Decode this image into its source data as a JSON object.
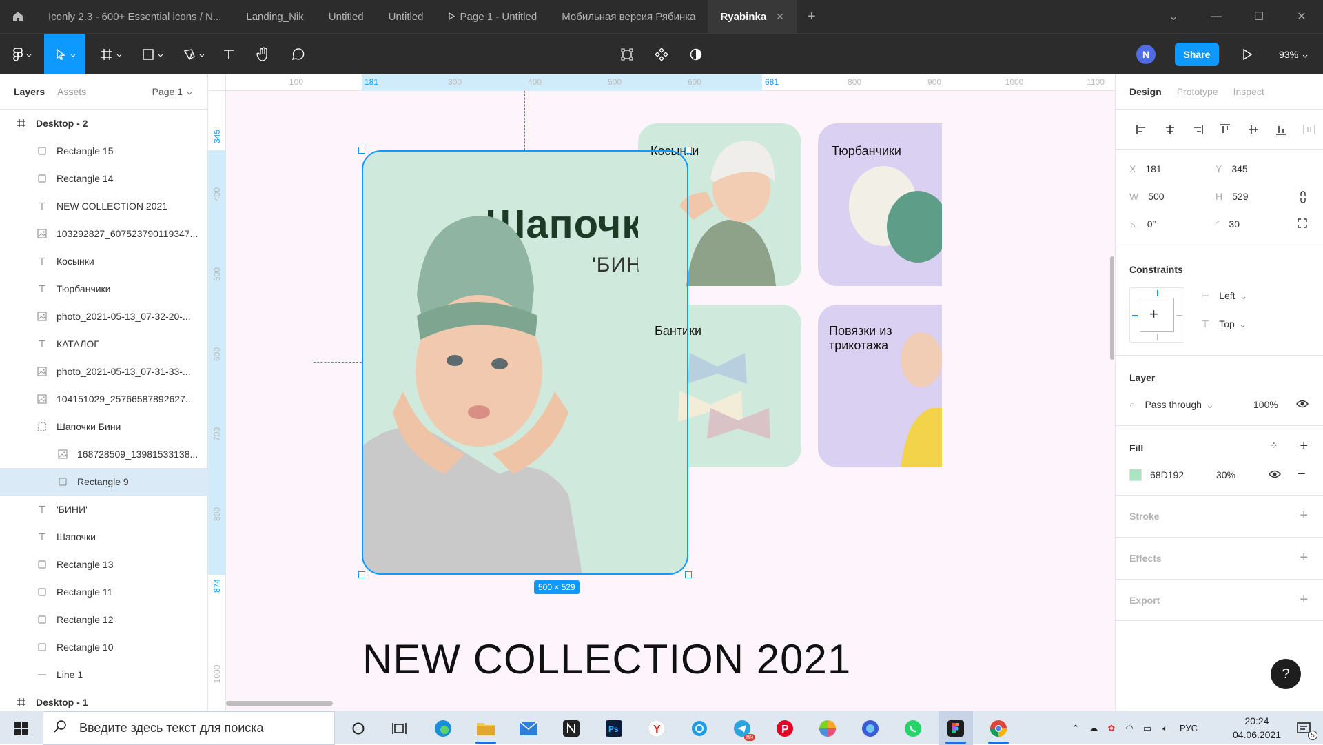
{
  "tabs": [
    {
      "label": "Iconly 2.3 - 600+ Essential icons / N...",
      "active": false,
      "play": false
    },
    {
      "label": "Landing_Nik",
      "active": false,
      "play": false
    },
    {
      "label": "Untitled",
      "active": false,
      "play": false
    },
    {
      "label": "Untitled",
      "active": false,
      "play": false
    },
    {
      "label": "Page 1 - Untitled",
      "active": false,
      "play": true
    },
    {
      "label": "Мобильная версия Рябинка",
      "active": false,
      "play": false
    },
    {
      "label": "Ryabinka",
      "active": true,
      "play": false
    }
  ],
  "toolbar": {
    "share_label": "Share",
    "zoom_label": "93%",
    "avatar_initial": "N"
  },
  "left_panel": {
    "tabs": {
      "layers": "Layers",
      "assets": "Assets"
    },
    "page_label": "Page 1",
    "layers": [
      {
        "name": "Desktop - 2",
        "icon": "frame-icon",
        "indent": 0,
        "frame": true
      },
      {
        "name": "Rectangle 15",
        "icon": "rectangle-icon",
        "indent": 1
      },
      {
        "name": "Rectangle 14",
        "icon": "rectangle-icon",
        "indent": 1
      },
      {
        "name": "NEW COLLECTION 2021",
        "icon": "text-icon",
        "indent": 1
      },
      {
        "name": "103292827_607523790119347...",
        "icon": "image-icon",
        "indent": 1
      },
      {
        "name": "Косынки",
        "icon": "text-icon",
        "indent": 1
      },
      {
        "name": "Тюрбанчики",
        "icon": "text-icon",
        "indent": 1
      },
      {
        "name": "photo_2021-05-13_07-32-20-...",
        "icon": "image-icon",
        "indent": 1
      },
      {
        "name": "КАТАЛОГ",
        "icon": "text-icon",
        "indent": 1
      },
      {
        "name": "photo_2021-05-13_07-31-33-...",
        "icon": "image-icon",
        "indent": 1
      },
      {
        "name": "104151029_25766587892627...",
        "icon": "image-icon",
        "indent": 1
      },
      {
        "name": "Шапочки Бини",
        "icon": "group-icon",
        "indent": 1
      },
      {
        "name": "168728509_13981533138...",
        "icon": "image-icon",
        "indent": 2
      },
      {
        "name": "Rectangle 9",
        "icon": "rectangle-icon",
        "indent": 2,
        "selected": true
      },
      {
        "name": "'БИНИ'",
        "icon": "text-icon",
        "indent": 1
      },
      {
        "name": "Шапочки",
        "icon": "text-icon",
        "indent": 1
      },
      {
        "name": "Rectangle 13",
        "icon": "rectangle-icon",
        "indent": 1
      },
      {
        "name": "Rectangle 11",
        "icon": "rectangle-icon",
        "indent": 1
      },
      {
        "name": "Rectangle 12",
        "icon": "rectangle-icon",
        "indent": 1
      },
      {
        "name": "Rectangle 10",
        "icon": "rectangle-icon",
        "indent": 1
      },
      {
        "name": "Line 1",
        "icon": "line-icon",
        "indent": 1
      },
      {
        "name": "Desktop - 1",
        "icon": "frame-icon",
        "indent": 0,
        "frame": true
      }
    ]
  },
  "rulers": {
    "top": [
      {
        "label": "100",
        "hl": false
      },
      {
        "label": "181",
        "hl": true
      },
      {
        "label": "300",
        "hl": false
      },
      {
        "label": "400",
        "hl": false
      },
      {
        "label": "500",
        "hl": false
      },
      {
        "label": "600",
        "hl": false
      },
      {
        "label": "681",
        "hl": true
      },
      {
        "label": "800",
        "hl": false
      },
      {
        "label": "900",
        "hl": false
      },
      {
        "label": "1000",
        "hl": false
      },
      {
        "label": "1100",
        "hl": false
      }
    ],
    "left": [
      {
        "label": "345",
        "hl": true
      },
      {
        "label": "400",
        "hl": false
      },
      {
        "label": "500",
        "hl": false
      },
      {
        "label": "600",
        "hl": false
      },
      {
        "label": "700",
        "hl": false
      },
      {
        "label": "800",
        "hl": false
      },
      {
        "label": "874",
        "hl": true
      },
      {
        "label": "1000",
        "hl": false
      }
    ]
  },
  "canvas": {
    "hero_title": "Шапочки",
    "hero_subtitle": "'БИНИ'",
    "cards": {
      "kosynki": "Косынки",
      "turbanchiki": "Тюрбанчики",
      "bantiki": "Бантики",
      "povyazki": "Повязки из трикотажа"
    },
    "new_collection": "NEW COLLECTION 2021",
    "size_badge": "500 × 529"
  },
  "right_panel": {
    "tabs": {
      "design": "Design",
      "prototype": "Prototype",
      "inspect": "Inspect"
    },
    "x_label": "X",
    "x": "181",
    "y_label": "Y",
    "y": "345",
    "w_label": "W",
    "w": "500",
    "h_label": "H",
    "h": "529",
    "rotation": "0°",
    "radius": "30",
    "constraints_title": "Constraints",
    "constraint_h": "Left",
    "constraint_v": "Top",
    "layer_title": "Layer",
    "blend": "Pass through",
    "opacity": "100%",
    "fill_title": "Fill",
    "fill_hex": "68D192",
    "fill_opacity": "30%",
    "stroke_title": "Stroke",
    "effects_title": "Effects",
    "export_title": "Export",
    "help": "?"
  },
  "taskbar": {
    "search_placeholder": "Введите здесь текст для поиска",
    "lang": "РУС",
    "time": "20:24",
    "date": "04.06.2021",
    "notif_count": "5",
    "telegram_badge": "89"
  },
  "colors": {
    "accent": "#0d99ff",
    "fill": "#68D192",
    "card_green": "#cfe9dc",
    "card_purple": "#d9d0f2",
    "canvas_bg": "#fdf5fb"
  }
}
